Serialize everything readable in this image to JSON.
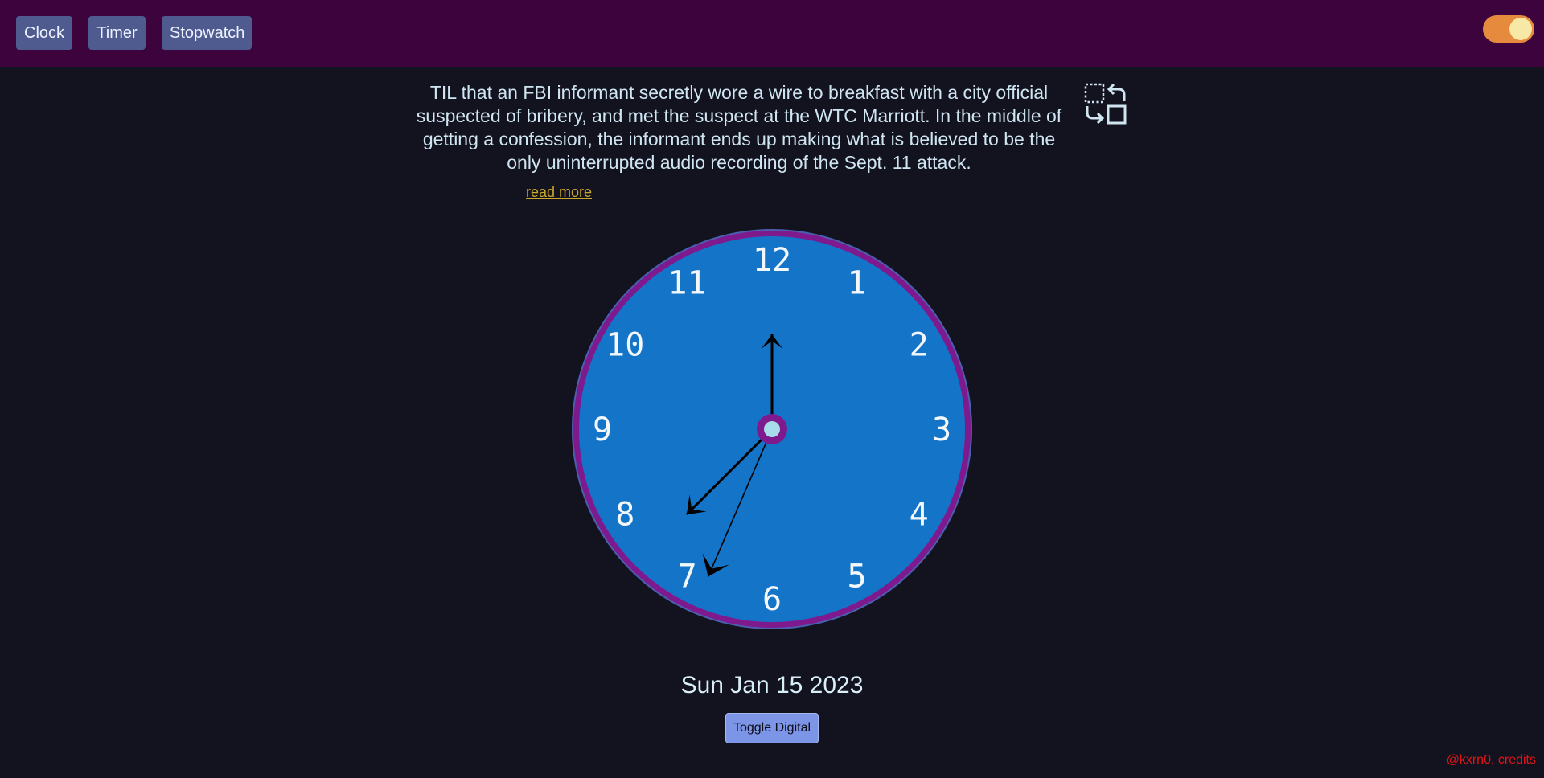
{
  "nav": {
    "clock_label": "Clock",
    "timer_label": "Timer",
    "stopwatch_label": "Stopwatch"
  },
  "theme_toggle": {
    "state": "on",
    "icon": "theme-toggle"
  },
  "fact": {
    "text": "TIL that an FBI informant secretly wore a wire to breakfast with a city official suspected of bribery, and met the suspect at the WTC Marriott. In the middle of getting a confession, the informant ends up making what is believed to be the only uninterrupted audio recording of the Sept. 11 attack.",
    "read_more_label": "read more"
  },
  "swap_icon": "swap-layout-icon",
  "clock": {
    "numerals": [
      "12",
      "1",
      "2",
      "3",
      "4",
      "5",
      "6",
      "7",
      "8",
      "9",
      "10",
      "11"
    ],
    "hour_hand_value": 12.0,
    "minute_hand_value": 37.5,
    "second_hand_value": 33.9,
    "face_color": "#1475c8",
    "rim_color": "#7e1a8e",
    "center_color": "#a9dcea"
  },
  "date": "Sun Jan 15 2023",
  "toggle_digital_label": "Toggle Digital",
  "credits": "@kxrn0, credits"
}
